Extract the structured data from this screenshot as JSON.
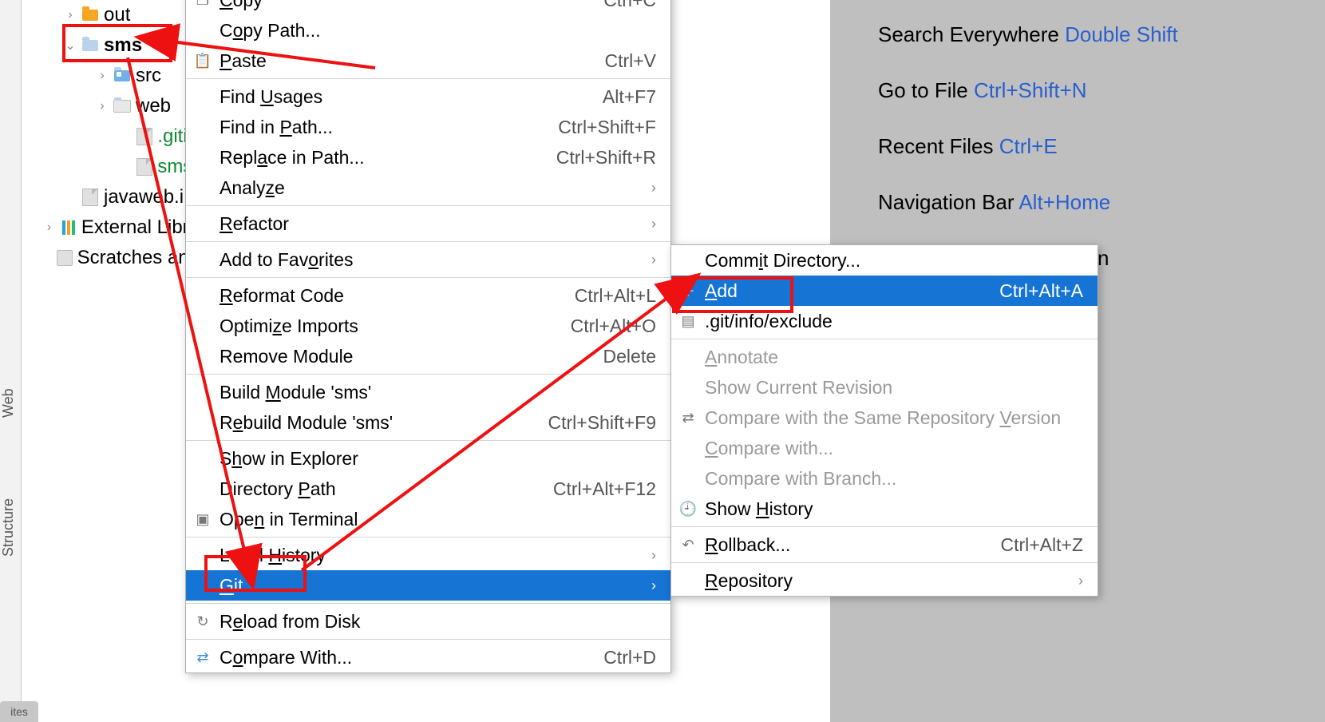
{
  "vtabs": {
    "web": "Web",
    "structure": "Structure",
    "bottom": "ites"
  },
  "tree": {
    "out": "out",
    "sms": "sms",
    "src": "src",
    "web": "web",
    "gitignore": ".gitign",
    "smsiml": "sms.im",
    "javaweb": "javaweb.i",
    "extlib": "External Libra",
    "scratches": "Scratches and"
  },
  "hints": {
    "search": {
      "label": "Search Everywhere ",
      "key": "Double Shift"
    },
    "goto": {
      "label": "Go to File ",
      "key": "Ctrl+Shift+N"
    },
    "recent": {
      "label": "Recent Files ",
      "key": "Ctrl+E"
    },
    "navbar": {
      "label": "Navigation Bar ",
      "key": "Alt+Home"
    },
    "hidden": "n"
  },
  "menu1": {
    "copy": {
      "label": "Copy",
      "sc": "Ctrl+C",
      "u": "C"
    },
    "copypath": {
      "label": "Copy Path...",
      "u": "o"
    },
    "paste": {
      "label": "Paste",
      "sc": "Ctrl+V",
      "u": "P"
    },
    "findusages": {
      "label": "Find Usages",
      "sc": "Alt+F7",
      "u": "U"
    },
    "findinpath": {
      "label": "Find in Path...",
      "sc": "Ctrl+Shift+F",
      "u": "P"
    },
    "replaceinpath": {
      "label": "Replace in Path...",
      "sc": "Ctrl+Shift+R",
      "u": "a"
    },
    "analyze": {
      "label": "Analyze",
      "u": "z"
    },
    "refactor": {
      "label": "Refactor",
      "u": "R"
    },
    "addfav": {
      "label": "Add to Favorites",
      "u": "o"
    },
    "reformat": {
      "label": "Reformat Code",
      "sc": "Ctrl+Alt+L",
      "u": "R"
    },
    "optimize": {
      "label": "Optimize Imports",
      "sc": "Ctrl+Alt+O",
      "u": "z"
    },
    "removemod": {
      "label": "Remove Module",
      "sc": "Delete"
    },
    "buildmod": {
      "label": "Build Module 'sms'",
      "u": "M"
    },
    "rebuildmod": {
      "label": "Rebuild Module 'sms'",
      "sc": "Ctrl+Shift+F9",
      "u": "e"
    },
    "showexp": {
      "label": "Show in Explorer",
      "u": "h"
    },
    "dirpath": {
      "label": "Directory Path",
      "sc": "Ctrl+Alt+F12",
      "u": "P"
    },
    "openterm": {
      "label": "Open in Terminal",
      "u": "n"
    },
    "localhist": {
      "label": "Local History",
      "u": "H"
    },
    "git": {
      "label": "Git",
      "u": "G"
    },
    "reload": {
      "label": "Reload from Disk",
      "u": "e"
    },
    "compare": {
      "label": "Compare With...",
      "sc": "Ctrl+D",
      "u": "o"
    }
  },
  "menu2": {
    "commitdir": {
      "label": "Commit Directory...",
      "u": "i"
    },
    "add": {
      "label": "Add",
      "sc": "Ctrl+Alt+A",
      "u": "A"
    },
    "exclude": {
      "label": ".git/info/exclude"
    },
    "annotate": {
      "label": "Annotate",
      "u": "A"
    },
    "showcur": {
      "label": "Show Current Revision"
    },
    "cmpsame": {
      "label": "Compare with the Same Repository Version",
      "u": "V"
    },
    "cmpwith": {
      "label": "Compare with...",
      "u": "C"
    },
    "cmpbranch": {
      "label": "Compare with Branch..."
    },
    "showhist": {
      "label": "Show History",
      "u": "H"
    },
    "rollback": {
      "label": "Rollback...",
      "sc": "Ctrl+Alt+Z",
      "u": "R"
    },
    "repository": {
      "label": "Repository",
      "u": "R"
    }
  }
}
